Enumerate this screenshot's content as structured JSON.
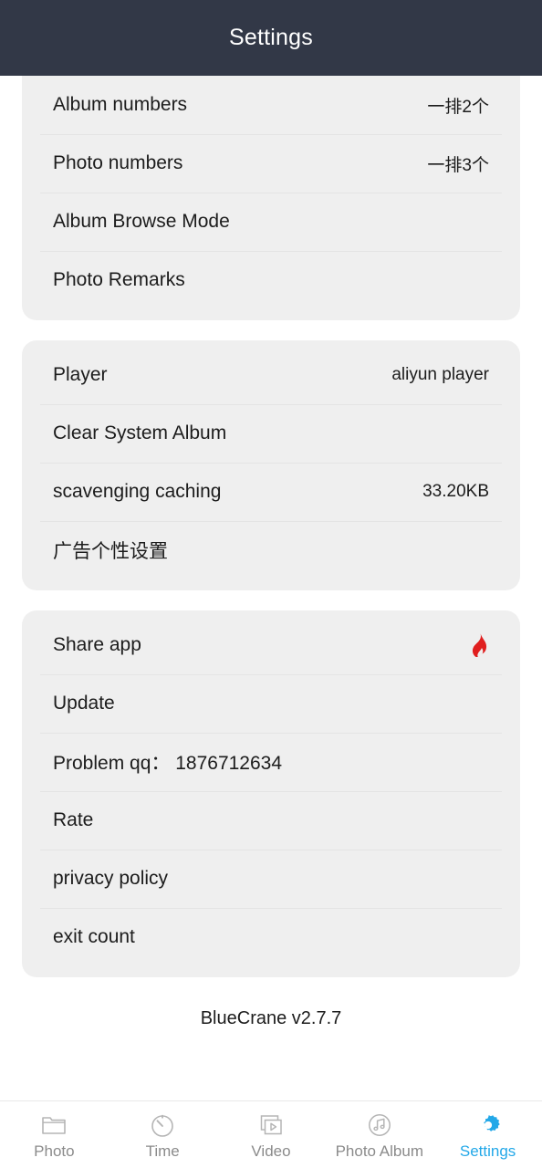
{
  "header": {
    "title": "Settings",
    "background_color": "#323847",
    "text_color": "#ffffff"
  },
  "accent_color": "#23a8e8",
  "flame_color": "#e01f1f",
  "card_color": "#efefef",
  "sections": [
    {
      "name": "display-settings",
      "clipped_top": true,
      "rows": [
        {
          "label": "Album numbers",
          "value": "一排2个"
        },
        {
          "label": "Photo numbers",
          "value": "一排3个"
        },
        {
          "label": "Album Browse Mode",
          "value": ""
        },
        {
          "label": "Photo Remarks",
          "value": ""
        }
      ]
    },
    {
      "name": "playback-settings",
      "clipped_top": false,
      "rows": [
        {
          "label": "Player",
          "value": "aliyun player"
        },
        {
          "label": "Clear System Album",
          "value": ""
        },
        {
          "label": "scavenging caching",
          "value": "33.20KB"
        },
        {
          "label": "广告个性设置",
          "value": ""
        }
      ]
    },
    {
      "name": "about-settings",
      "clipped_top": false,
      "rows": [
        {
          "label": "Share app",
          "value": "",
          "icon": "flame-icon"
        },
        {
          "label": "Update",
          "value": ""
        },
        {
          "label": "Problem qq： 1876712634",
          "value": ""
        },
        {
          "label": "Rate",
          "value": ""
        },
        {
          "label": "privacy policy",
          "value": ""
        },
        {
          "label": "exit count",
          "value": ""
        }
      ]
    }
  ],
  "version": "BlueCrane v2.7.7",
  "tabbar": {
    "tabs": [
      {
        "label": "Photo",
        "icon": "folder-icon",
        "active": false
      },
      {
        "label": "Time",
        "icon": "clock-icon",
        "active": false
      },
      {
        "label": "Video",
        "icon": "video-icon",
        "active": false
      },
      {
        "label": "Photo Album",
        "icon": "music-note-icon",
        "active": false
      },
      {
        "label": "Settings",
        "icon": "gear-icon",
        "active": true
      }
    ]
  }
}
